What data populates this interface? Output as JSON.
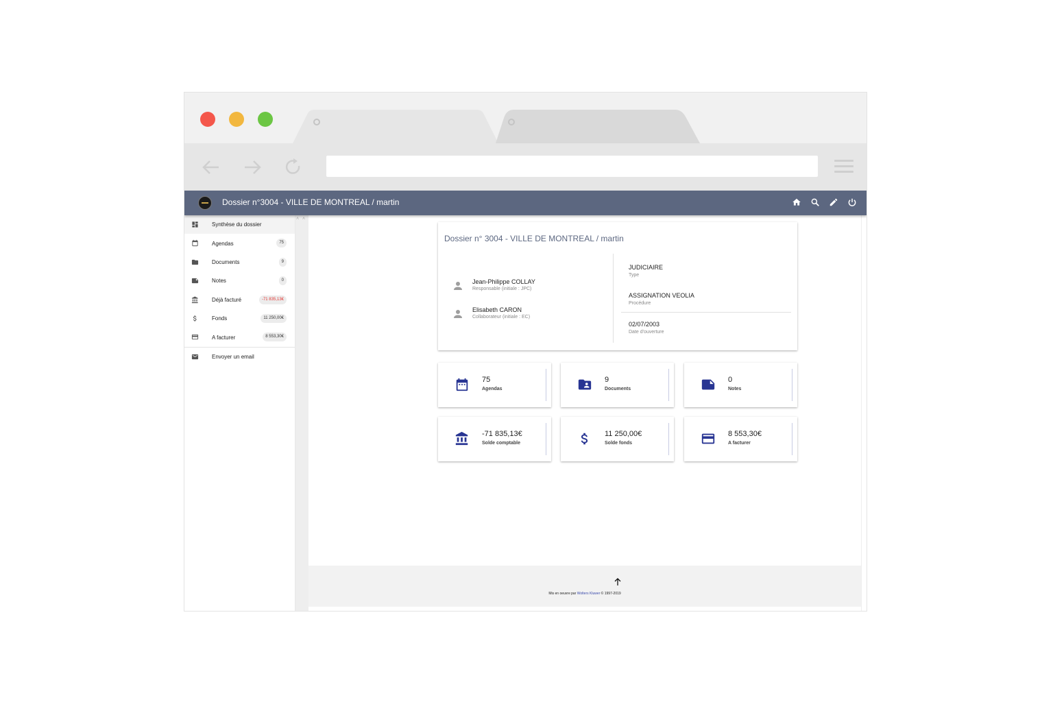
{
  "app": {
    "title": "Dossier n°3004 - VILLE DE MONTREAL / martin",
    "actions": [
      "home-icon",
      "search-icon",
      "edit-icon",
      "power-icon"
    ]
  },
  "sidebar": {
    "items": [
      {
        "label": "Synthèse du dossier",
        "icon": "dashboard-icon",
        "badge": ""
      },
      {
        "label": "Agendas",
        "icon": "calendar-icon",
        "badge": "75"
      },
      {
        "label": "Documents",
        "icon": "folder-icon",
        "badge": "9"
      },
      {
        "label": "Notes",
        "icon": "note-icon",
        "badge": "0"
      },
      {
        "label": "Déjà facturé",
        "icon": "bank-icon",
        "badge": "-71 835,13€"
      },
      {
        "label": "Fonds",
        "icon": "dollar-icon",
        "badge": "11 250,00€"
      },
      {
        "label": "A facturer",
        "icon": "credit-card-icon",
        "badge": "8 553,30€"
      }
    ],
    "email": {
      "label": "Envoyer un email",
      "icon": "mail-icon"
    }
  },
  "summary": {
    "title": "Dossier n° 3004 - VILLE DE MONTREAL / martin",
    "people": [
      {
        "name": "Jean-Philippe COLLAY",
        "role": "Responsable (initiale : JPC)"
      },
      {
        "name": "Elisabeth CARON",
        "role": "Collaborateur (initiale : EC)"
      }
    ],
    "fields": [
      {
        "value": "JUDICIAIRE",
        "key": "Type"
      },
      {
        "value": "ASSIGNATION VEOLIA",
        "key": "Procédure"
      },
      {
        "value": "02/07/2003",
        "key": "Date d'ouverture"
      }
    ]
  },
  "stats": [
    {
      "value": "75",
      "label": "Agendas",
      "icon": "calendar-icon"
    },
    {
      "value": "9",
      "label": "Documents",
      "icon": "folder-account-icon"
    },
    {
      "value": "0",
      "label": "Notes",
      "icon": "note-icon"
    },
    {
      "value": "-71 835,13€",
      "label": "Solde comptable",
      "icon": "bank-icon"
    },
    {
      "value": "11 250,00€",
      "label": "Solde fonds",
      "icon": "dollar-icon"
    },
    {
      "value": "8 553,30€",
      "label": "A facturer",
      "icon": "credit-card-icon"
    }
  ],
  "footer": {
    "credit_prefix": "Mis en oeuvre par ",
    "credit_link": "Wolters Kluwer",
    "credit_suffix": " © 1997-2019"
  },
  "colors": {
    "appbar": "#5c6780",
    "accent": "#283593",
    "negative": "#e53935"
  }
}
